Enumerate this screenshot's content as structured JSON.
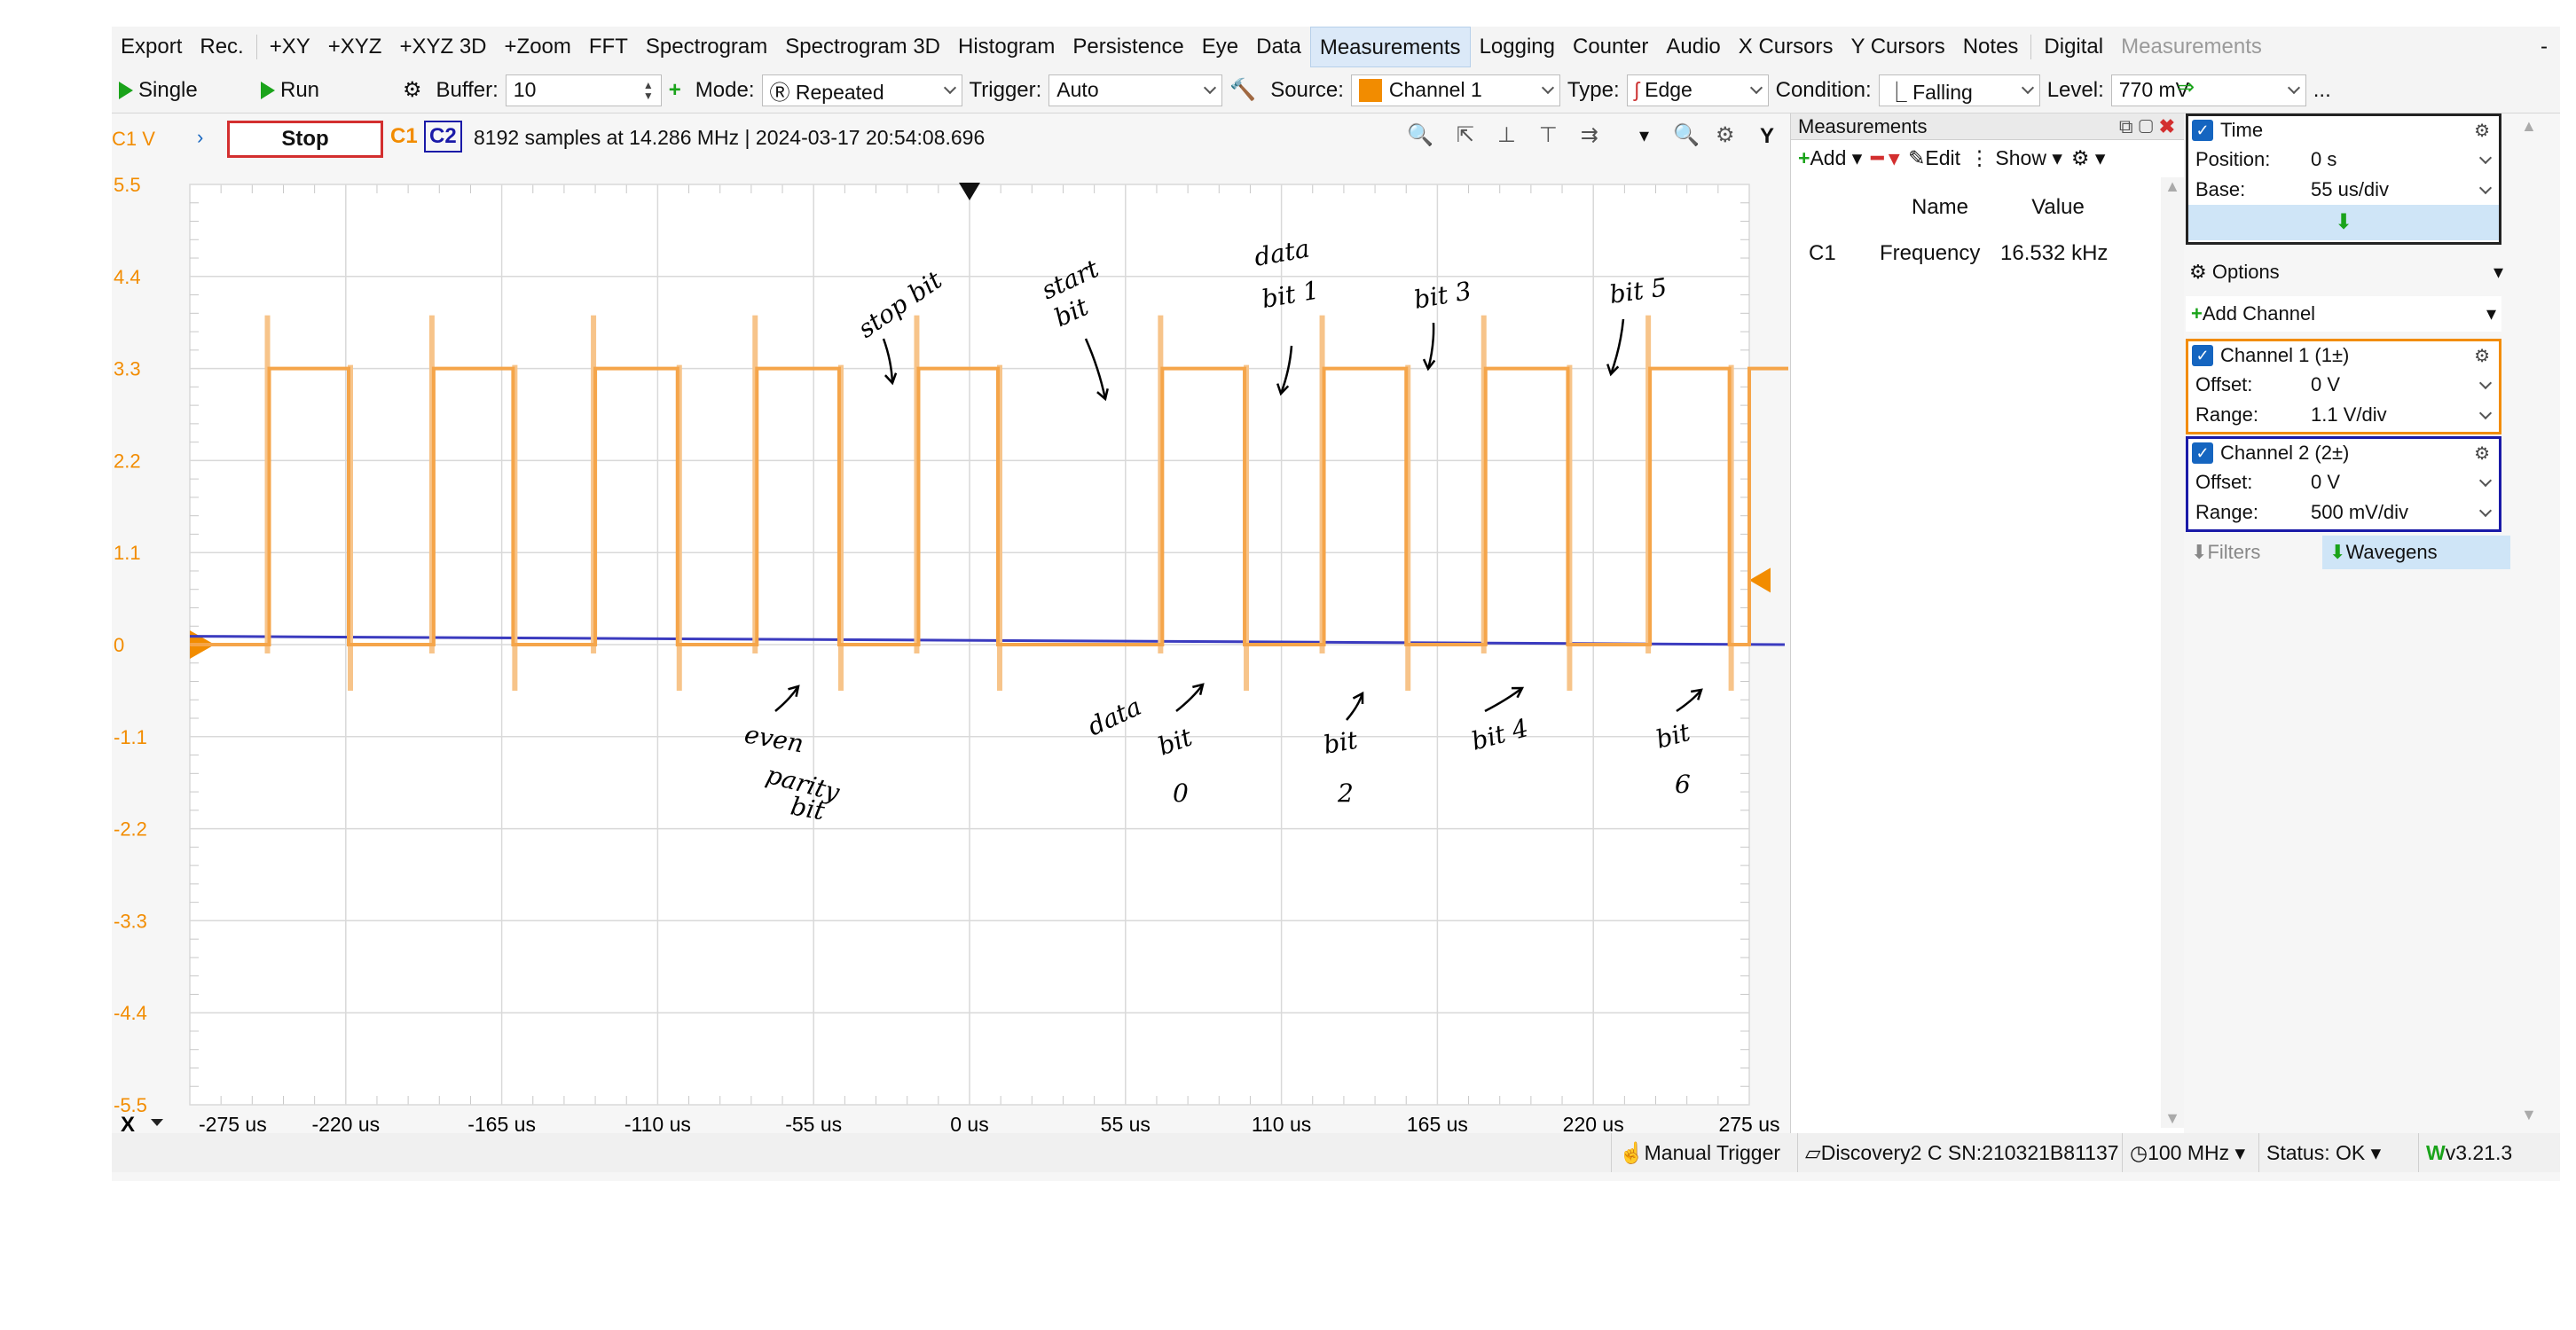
{
  "menu": [
    "Export",
    "Rec.",
    "+XY",
    "+XYZ",
    "+XYZ 3D",
    "+Zoom",
    "FFT",
    "Spectrogram",
    "Spectrogram 3D",
    "Histogram",
    "Persistence",
    "Eye",
    "Data",
    "Measurements",
    "Logging",
    "Counter",
    "Audio",
    "X Cursors",
    "Y Cursors",
    "Notes",
    "Digital",
    "Measurements"
  ],
  "menu_close": "-",
  "toolbar": {
    "single": "Single",
    "run": "Run",
    "buffer_label": "Buffer:",
    "buffer_value": "10",
    "mode_label": "Mode:",
    "mode_value": "Repeated",
    "trigger_label": "Trigger:",
    "trigger_value": "Auto",
    "source_label": "Source:",
    "source_value": "Channel 1",
    "type_label": "Type:",
    "type_value": "Edge",
    "condition_label": "Condition:",
    "condition_value": "Falling",
    "level_label": "Level:",
    "level_value": "770 mV",
    "more": "..."
  },
  "scope": {
    "y_unit": "C1 V",
    "stop": "Stop",
    "c1": "C1",
    "c2": "C2",
    "info": "8192 samples at 14.286 MHz  | 2024-03-17 20:54:08.696",
    "y_btn": "Y",
    "x_btn": "X",
    "y_ticks": [
      "5.5",
      "4.4",
      "3.3",
      "2.2",
      "1.1",
      "0",
      "-1.1",
      "-2.2",
      "-3.3",
      "-4.4",
      "-5.5"
    ],
    "x_ticks": [
      "-275 us",
      "-220 us",
      "-165 us",
      "-110 us",
      "-55 us",
      "0 us",
      "55 us",
      "110 us",
      "165 us",
      "220 us",
      "275 us"
    ]
  },
  "annotations": {
    "stop_bit": "stop bit",
    "start_bit": [
      "start",
      "bit"
    ],
    "data_bit1": [
      "data",
      "bit 1"
    ],
    "bit3": "bit 3",
    "bit5": "bit 5",
    "even_parity": [
      "even",
      "parity",
      "bit"
    ],
    "data_bit0": [
      "data",
      "bit",
      "0"
    ],
    "bit2": [
      "bit",
      "2"
    ],
    "bit4": "bit 4",
    "bit6": [
      "bit",
      "6"
    ]
  },
  "chart_data": {
    "type": "line",
    "title": "",
    "xlabel": "",
    "ylabel": "C1 V",
    "xlim": [
      -275,
      275
    ],
    "ylim": [
      -5.5,
      5.5
    ],
    "x_unit": "us",
    "series": [
      {
        "name": "C1",
        "color": "#f5a54a",
        "high_intervals_us": [
          [
            -247,
            -219
          ],
          [
            -189,
            -161
          ],
          [
            -132,
            -103
          ],
          [
            -75,
            -46
          ],
          [
            -18,
            10
          ],
          [
            68,
            97
          ],
          [
            125,
            154
          ],
          [
            182,
            211
          ],
          [
            240,
            268
          ]
        ],
        "high_level": 3.3,
        "low_level": 0.0
      },
      {
        "name": "C2",
        "color": "#3b3bbf",
        "level_start": 0.1,
        "level_end": 0.0
      }
    ]
  },
  "measurements": {
    "title": "Measurements",
    "add": "Add",
    "edit": "Edit",
    "show": "Show",
    "col_name": "Name",
    "col_value": "Value",
    "rows": [
      {
        "ch": "C1",
        "name": "Frequency",
        "value": "16.532 kHz"
      }
    ]
  },
  "right": {
    "time": {
      "title": "Time",
      "position_label": "Position:",
      "position_value": "0 s",
      "base_label": "Base:",
      "base_value": "55 us/div"
    },
    "options": "Options",
    "add_channel": "Add Channel",
    "ch1": {
      "title": "Channel 1 (1±)",
      "offset_label": "Offset:",
      "offset_value": "0 V",
      "range_label": "Range:",
      "range_value": "1.1 V/div",
      "color": "#f28c00"
    },
    "ch2": {
      "title": "Channel 2 (2±)",
      "offset_label": "Offset:",
      "offset_value": "0 V",
      "range_label": "Range:",
      "range_value": "500 mV/div",
      "color": "#1a1aa8"
    },
    "filters": "Filters",
    "wavegens": "Wavegens"
  },
  "status": {
    "manual_trigger": "Manual Trigger",
    "device": "Discovery2 C SN:210321B81137",
    "rate": "100 MHz",
    "status": "Status: OK",
    "version": "v3.21.3"
  }
}
